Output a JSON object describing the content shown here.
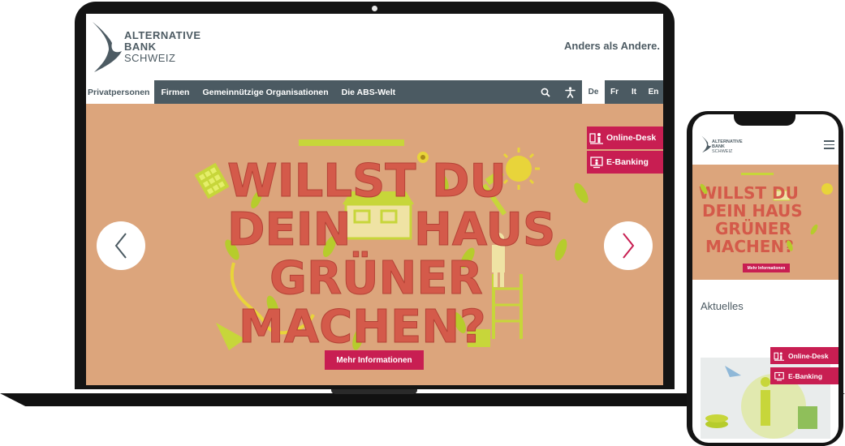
{
  "brand": {
    "line1": "ALTERNATIVE",
    "line2": "BANK",
    "line3": "SCHWEIZ",
    "slogan": "Anders als Andere."
  },
  "nav": {
    "items": [
      {
        "label": "Privatpersonen",
        "active": true
      },
      {
        "label": "Firmen",
        "active": false
      },
      {
        "label": "Gemeinnützige Organisationen",
        "active": false
      },
      {
        "label": "Die ABS-Welt",
        "active": false
      }
    ],
    "icons": [
      "search-icon",
      "accessibility-icon"
    ],
    "languages": [
      {
        "label": "De",
        "active": true
      },
      {
        "label": "Fr",
        "active": false
      },
      {
        "label": "It",
        "active": false
      },
      {
        "label": "En",
        "active": false
      }
    ]
  },
  "hero": {
    "headline_line1": "WILLST DU",
    "headline_line2_a": "DEIN",
    "headline_line2_b": "HAUS",
    "headline_line3": "GRÜNER",
    "headline_line4": "MACHEN?",
    "cta_label": "Mehr Informationen",
    "online_desk_label": "Online-Desk",
    "ebanking_label": "E-Banking",
    "prev_icon": "chevron-left-icon",
    "next_icon": "chevron-right-icon"
  },
  "phone": {
    "brand_line1": "ALTERNATIVE",
    "brand_line2": "BANK",
    "brand_line3": "SCHWEIZ",
    "hero_line1": "WILLST DU",
    "hero_line2": "DEIN HAUS",
    "hero_line3": "GRÜNER",
    "hero_line4": "MACHEN?",
    "cta_label": "Mehr Informationen",
    "news_heading": "Aktuelles",
    "online_desk_label": "Online-Desk",
    "ebanking_label": "E-Banking"
  },
  "colors": {
    "accent": "#c81e52",
    "nav": "#4b5a62",
    "hero_bg": "#dca57c",
    "headline": "#d45a4a",
    "leaf": "#b6cc2c"
  }
}
